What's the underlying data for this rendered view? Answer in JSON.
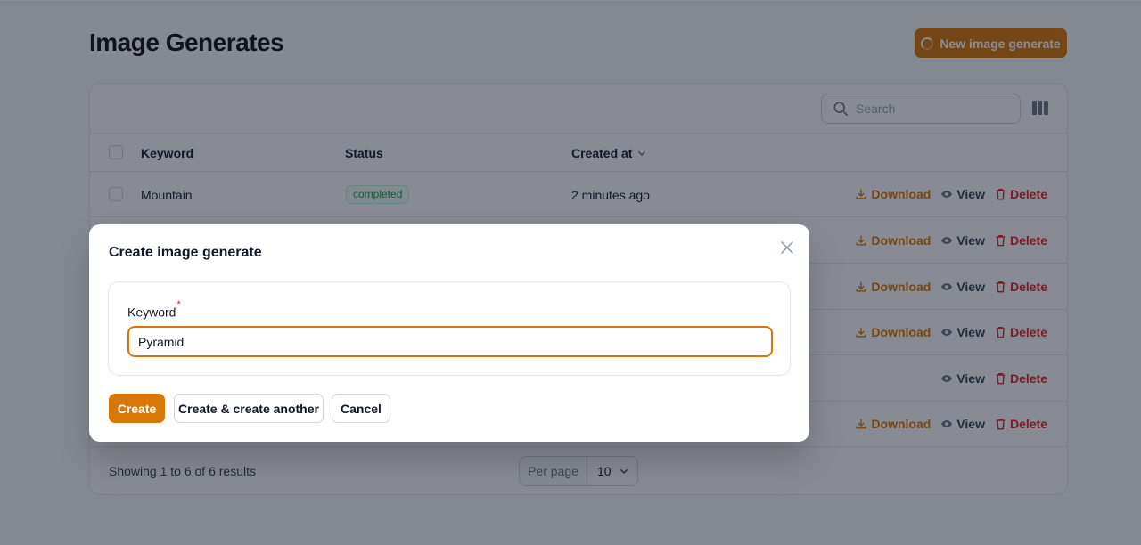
{
  "page": {
    "title": "Image Generates",
    "new_button_label": "New image generate"
  },
  "table": {
    "search_placeholder": "Search",
    "headers": {
      "keyword": "Keyword",
      "status": "Status",
      "created_at": "Created at"
    },
    "rows": [
      {
        "keyword": "Mountain",
        "status": "completed",
        "created_at": "2 minutes ago",
        "has_download": true
      },
      {
        "keyword": "",
        "status": "",
        "created_at": "",
        "has_download": true
      },
      {
        "keyword": "",
        "status": "",
        "created_at": "",
        "has_download": true
      },
      {
        "keyword": "",
        "status": "",
        "created_at": "",
        "has_download": true
      },
      {
        "keyword": "",
        "status": "",
        "created_at": "",
        "has_download": false
      },
      {
        "keyword": "",
        "status": "",
        "created_at": "",
        "has_download": true
      }
    ],
    "actions": {
      "download": "Download",
      "view": "View",
      "delete": "Delete"
    },
    "footer": {
      "showing": "Showing 1 to 6 of 6 results",
      "per_page_label": "Per page",
      "per_page_value": "10"
    }
  },
  "modal": {
    "title": "Create image generate",
    "field_label": "Keyword",
    "required_mark": "*",
    "field_value": "Pyramid",
    "create_label": "Create",
    "create_another_label": "Create & create another",
    "cancel_label": "Cancel"
  },
  "colors": {
    "primary": "#d97706",
    "danger": "#dc2626",
    "success": "#16a34a"
  }
}
